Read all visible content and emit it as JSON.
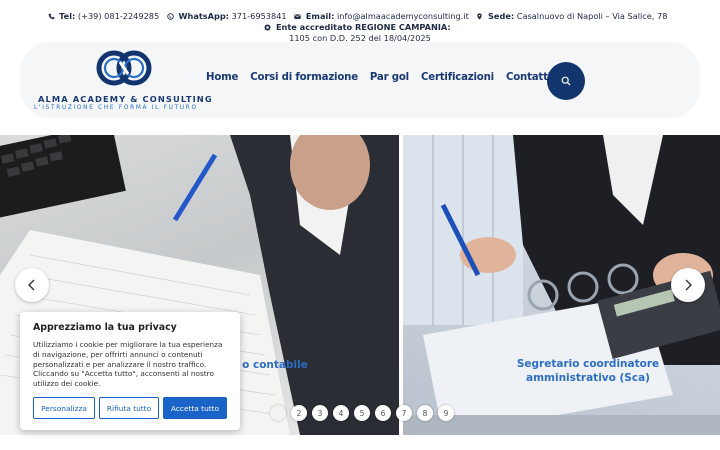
{
  "topbar": {
    "tel_label": "Tel:",
    "tel_value": "(+39) 081-2249285",
    "whatsapp_label": "WhatsApp:",
    "whatsapp_value": "371-6953841",
    "email_label": "Email:",
    "email_value": "info@almaacademyconsulting.it",
    "sede_label": "Sede:",
    "sede_value": "Casalnuovo di Napoli – Via Salice, 78",
    "ente_label": "Ente accreditato REGIONE CAMPANIA:",
    "ente_value": "1105 con D.D. 252 del 18/04/2025"
  },
  "header": {
    "brand": "ALMA ACADEMY & CONSULTING",
    "tagline": "L'ISTRUZIONE CHE FORMA IL FUTURO",
    "nav": [
      "Home",
      "Corsi di formazione",
      "Par gol",
      "Certificazioni",
      "Contatti"
    ],
    "search_icon": "search-icon"
  },
  "carousel": {
    "slide1_caption": "o contabile",
    "slide2_caption": "Segretario coordinatore amministrativo (Sca)",
    "prev_icon": "chevron-left-icon",
    "next_icon": "chevron-right-icon",
    "dots": [
      "",
      "2",
      "3",
      "4",
      "5",
      "6",
      "7",
      "8",
      "9"
    ]
  },
  "cookie": {
    "title": "Apprezziamo la tua privacy",
    "text": "Utilizziamo i cookie per migliorare la tua esperienza di navigazione, per offrirti annunci o contenuti personalizzati e per analizzare il nostro traffico. Cliccando su \"Accetta tutto\", acconsenti al nostro utilizzo dei cookie.",
    "btn_customize": "Personalizza",
    "btn_reject": "Rifiuta tutto",
    "btn_accept": "Accetta tutto"
  },
  "colors": {
    "primary_navy": "#12356e",
    "accent_blue": "#1a63c9",
    "caption_blue": "#2d6ec5"
  }
}
